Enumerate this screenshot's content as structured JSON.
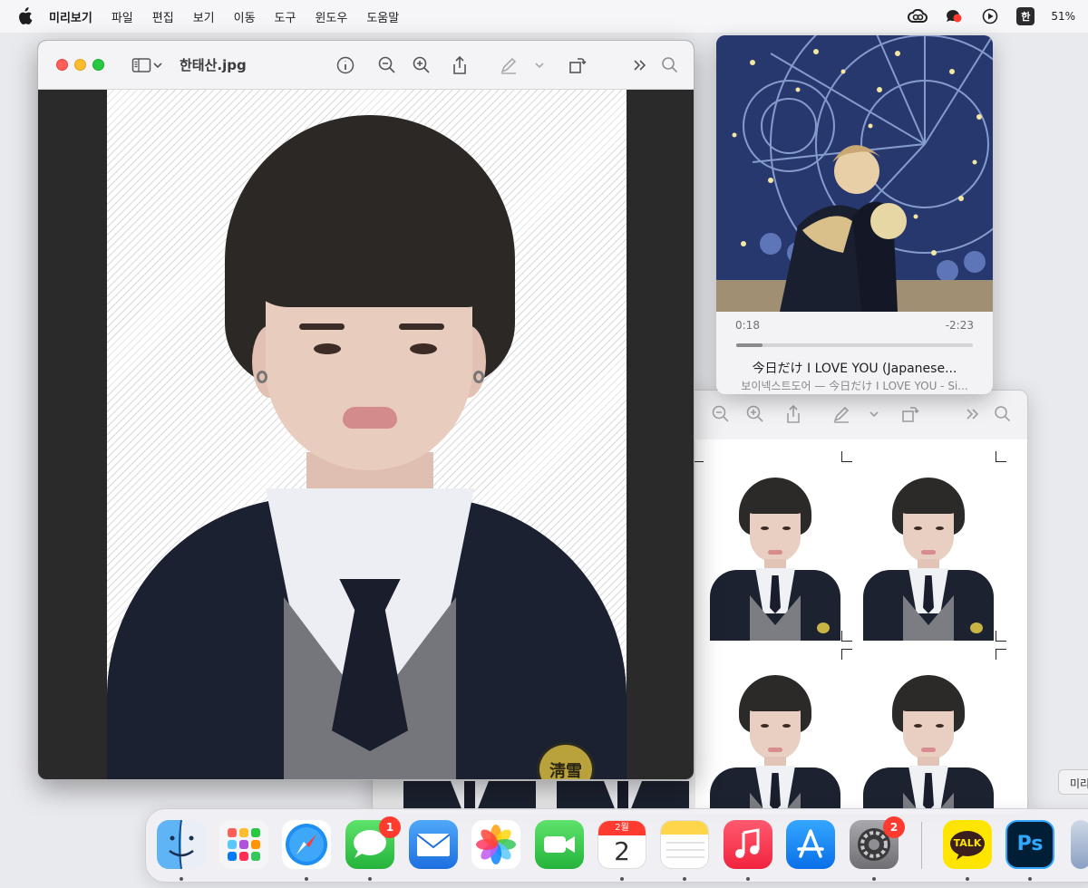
{
  "menubar": {
    "app_name": "미리보기",
    "items": [
      "파일",
      "편집",
      "보기",
      "이동",
      "도구",
      "윈도우",
      "도움말"
    ],
    "input_source": "한",
    "battery": "51%"
  },
  "preview": {
    "title": "한태산.jpg",
    "toolbar_icons": [
      "sidebar-icon",
      "chevron-down-icon",
      "info-icon",
      "zoom-out-icon",
      "zoom-in-icon",
      "share-icon",
      "markup-icon",
      "chevron-down-icon",
      "rotate-icon",
      "more-icon",
      "search-icon"
    ],
    "badge_text": "淸雪"
  },
  "music": {
    "time_elapsed": "0:18",
    "time_remaining": "-2:23",
    "progress": 0.11,
    "title": "今日だけ I LOVE YOU (Japanese...",
    "subtitle": "보이넥스트도어 — 今日だけ I LOVE YOU - Si..."
  },
  "side_tooltip": "미리",
  "dock": {
    "apps": [
      {
        "name": "Finder",
        "icon": "finder-icon"
      },
      {
        "name": "Launchpad",
        "icon": "launchpad-icon"
      },
      {
        "name": "Safari",
        "icon": "safari-icon"
      },
      {
        "name": "Messages",
        "icon": "messages-icon",
        "badge": "1"
      },
      {
        "name": "Mail",
        "icon": "mail-icon"
      },
      {
        "name": "Photos",
        "icon": "photos-icon"
      },
      {
        "name": "FaceTime",
        "icon": "facetime-icon"
      },
      {
        "name": "Calendar",
        "icon": "calendar-icon",
        "month": "2월",
        "day": "2"
      },
      {
        "name": "Notes",
        "icon": "notes-icon"
      },
      {
        "name": "Music",
        "icon": "music-icon"
      },
      {
        "name": "App Store",
        "icon": "appstore-icon"
      },
      {
        "name": "System Settings",
        "icon": "settings-icon",
        "badge": "2"
      },
      {
        "name": "KakaoTalk",
        "icon": "kakaotalk-icon",
        "label": "TALK"
      },
      {
        "name": "Photoshop",
        "icon": "photoshop-icon",
        "label": "Ps"
      }
    ]
  },
  "colors": {
    "accent_red": "#ff3b30",
    "window_bg": "#f4f4f6",
    "jacket": "#1b2130"
  }
}
